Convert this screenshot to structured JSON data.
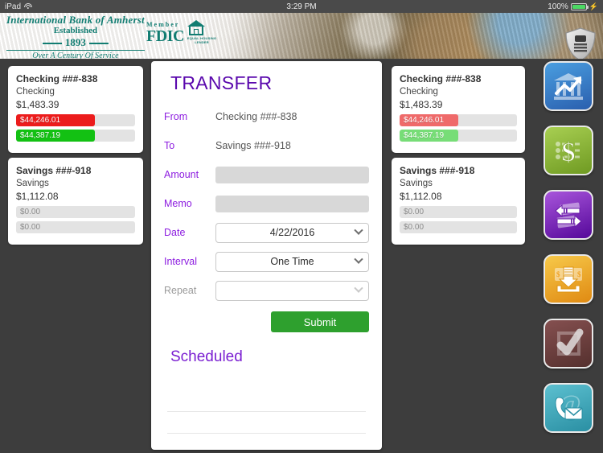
{
  "statusbar": {
    "device": "iPad",
    "wifi_icon": "wifi-icon",
    "time": "3:29 PM",
    "battery_percent": "100%",
    "battery_icon": "battery-charging-icon"
  },
  "header": {
    "logo": {
      "line1": "International Bank of Amherst",
      "line2": "Established",
      "line3": "1893",
      "line4": "Over A Century Of Service",
      "color": "#127d72"
    },
    "fdic": {
      "member_label": "Member",
      "fdic_label": "FDIC",
      "lender_line1": "EQUAL HOUSING",
      "lender_line2": "LENDER"
    },
    "shield_icon": "security-shield-icon"
  },
  "accounts_left": [
    {
      "name": "Checking ###-838",
      "type": "Checking",
      "balance": "$1,483.39",
      "bars": [
        {
          "label": "$44,246.01",
          "color": "#ec1c1c",
          "pct": 66,
          "empty": false
        },
        {
          "label": "$44,387.19",
          "color": "#13c113",
          "pct": 66,
          "empty": false
        }
      ]
    },
    {
      "name": "Savings ###-918",
      "type": "Savings",
      "balance": "$1,112.08",
      "bars": [
        {
          "label": "$0.00",
          "color": "#e3e3e3",
          "pct": 0,
          "empty": true
        },
        {
          "label": "$0.00",
          "color": "#e3e3e3",
          "pct": 0,
          "empty": true
        }
      ]
    }
  ],
  "accounts_right": [
    {
      "name": "Checking ###-838",
      "type": "Checking",
      "balance": "$1,483.39",
      "bars": [
        {
          "label": "$44,246.01",
          "color": "#ef6a6a",
          "pct": 50,
          "empty": false
        },
        {
          "label": "$44,387.19",
          "color": "#77dd77",
          "pct": 50,
          "empty": false
        }
      ]
    },
    {
      "name": "Savings ###-918",
      "type": "Savings",
      "balance": "$1,112.08",
      "bars": [
        {
          "label": "$0.00",
          "color": "#e8e8e8",
          "pct": 0,
          "empty": true
        },
        {
          "label": "$0.00",
          "color": "#e8e8e8",
          "pct": 0,
          "empty": true
        }
      ]
    }
  ],
  "transfer": {
    "title": "TRANSFER",
    "accent_color": "#8d1de0",
    "from_label": "From",
    "from_value": "Checking ###-838",
    "to_label": "To",
    "to_value": "Savings ###-918",
    "amount_label": "Amount",
    "amount_value": "",
    "amount_placeholder": "",
    "memo_label": "Memo",
    "memo_value": "",
    "memo_placeholder": "",
    "date_label": "Date",
    "date_value": "4/22/2016",
    "interval_label": "Interval",
    "interval_value": "One Time",
    "repeat_label": "Repeat",
    "repeat_value": "",
    "submit_label": "Submit",
    "scheduled_title": "Scheduled",
    "scheduled_items": []
  },
  "rail": [
    {
      "name": "accounts-overview-button",
      "icon": "bank-chart-icon",
      "color_a": "#3f8fd6",
      "color_b": "#2a5fae"
    },
    {
      "name": "payments-button",
      "icon": "dollar-sign-icon",
      "color_a": "#9cc449",
      "color_b": "#6f9a22"
    },
    {
      "name": "transfers-button",
      "icon": "transfer-arrows-icon",
      "color_a": "#9b3fd1",
      "color_b": "#5c0d9c"
    },
    {
      "name": "deposit-button",
      "icon": "deposit-money-icon",
      "color_a": "#f5b93c",
      "color_b": "#e08a12"
    },
    {
      "name": "approvals-button",
      "icon": "checkbox-check-icon",
      "color_a": "#7b4a4a",
      "color_b": "#5a3030"
    },
    {
      "name": "contact-button",
      "icon": "contact-mail-icon",
      "color_a": "#4fb3c4",
      "color_b": "#2a8fa3"
    }
  ]
}
